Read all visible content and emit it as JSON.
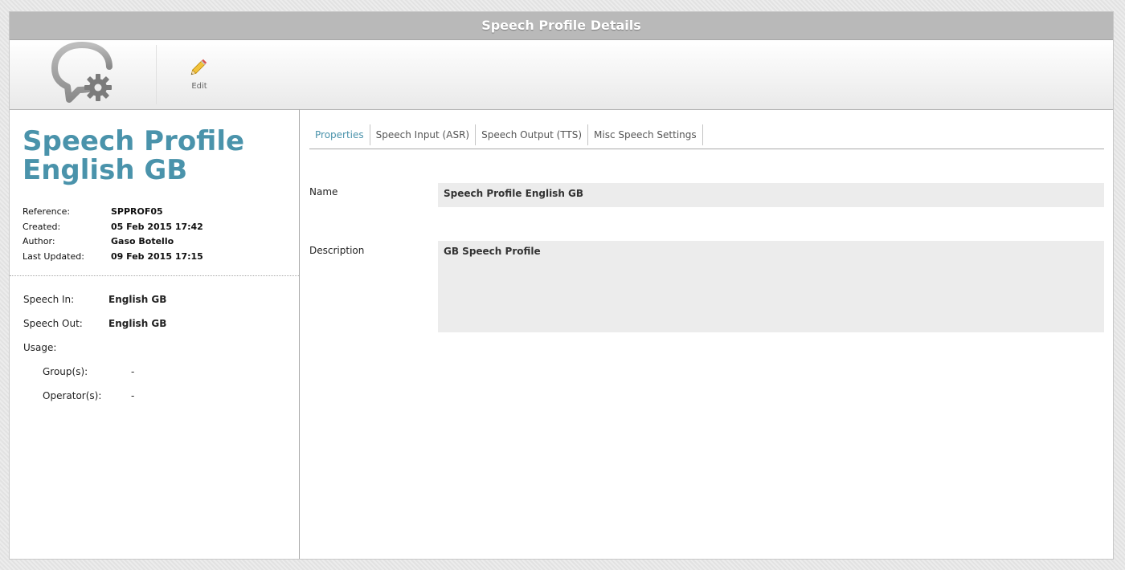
{
  "window": {
    "title": "Speech Profile Details"
  },
  "toolbar": {
    "edit_label": "Edit"
  },
  "profile": {
    "title_line1": "Speech Profile",
    "title_line2": "English GB",
    "meta": [
      {
        "label": "Reference:",
        "value": "SPPROF05"
      },
      {
        "label": "Created:",
        "value": "05 Feb 2015 17:42"
      },
      {
        "label": "Author:",
        "value": "Gaso Botello"
      },
      {
        "label": "Last Updated:",
        "value": "09 Feb 2015 17:15"
      }
    ],
    "info": {
      "speech_in_label": "Speech In:",
      "speech_in_value": "English GB",
      "speech_out_label": "Speech Out:",
      "speech_out_value": "English GB",
      "usage_label": "Usage:",
      "groups_label": "Group(s):",
      "groups_value": "-",
      "operators_label": "Operator(s):",
      "operators_value": "-"
    }
  },
  "tabs": [
    {
      "label": "Properties",
      "active": true
    },
    {
      "label": "Speech Input (ASR)",
      "active": false
    },
    {
      "label": "Speech Output (TTS)",
      "active": false
    },
    {
      "label": "Misc Speech Settings",
      "active": false
    }
  ],
  "properties": {
    "name_label": "Name",
    "name_value": "Speech Profile English GB",
    "description_label": "Description",
    "description_value": "GB Speech Profile"
  },
  "colors": {
    "accent": "#4a93ab",
    "titlebar": "#b9b9b9",
    "field_bg": "#ececec"
  },
  "icons": {
    "logo": "speech-bubble-gear-icon",
    "edit": "pencil-icon"
  }
}
